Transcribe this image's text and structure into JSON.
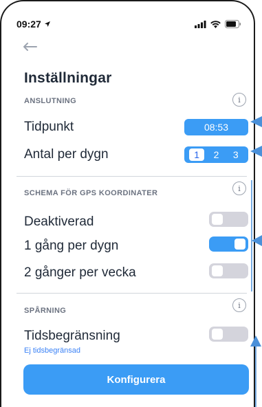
{
  "status_bar": {
    "time": "09:27"
  },
  "page": {
    "title": "Inställningar"
  },
  "sections": {
    "anslutning": {
      "header": "ANSLUTNING",
      "tidpunkt_label": "Tidpunkt",
      "tidpunkt_value": "08:53",
      "antal_label": "Antal per dygn",
      "antal_options": [
        "1",
        "2",
        "3"
      ],
      "antal_selected": "1"
    },
    "schema": {
      "header": "SCHEMA FÖR GPS KOORDINATER",
      "items": [
        {
          "label": "Deaktiverad",
          "on": false
        },
        {
          "label": "1 gång per dygn",
          "on": true
        },
        {
          "label": "2 gånger per vecka",
          "on": false
        }
      ]
    },
    "sparning": {
      "header": "SPÅRNING",
      "tids_label": "Tidsbegränsning",
      "tids_sub": "Ej tidsbegränsad",
      "tids_on": false
    }
  },
  "actions": {
    "configure_label": "Konfigurera"
  },
  "icons": {
    "back": "back-arrow-icon",
    "info": "info-icon",
    "location": "location-arrow-icon",
    "signal": "signal-icon",
    "wifi": "wifi-icon",
    "battery": "battery-icon"
  },
  "colors": {
    "accent": "#3b9cf5",
    "toggle_off": "#d4d4dc",
    "annotation": "#4a90d9",
    "link": "#3b82f6"
  }
}
